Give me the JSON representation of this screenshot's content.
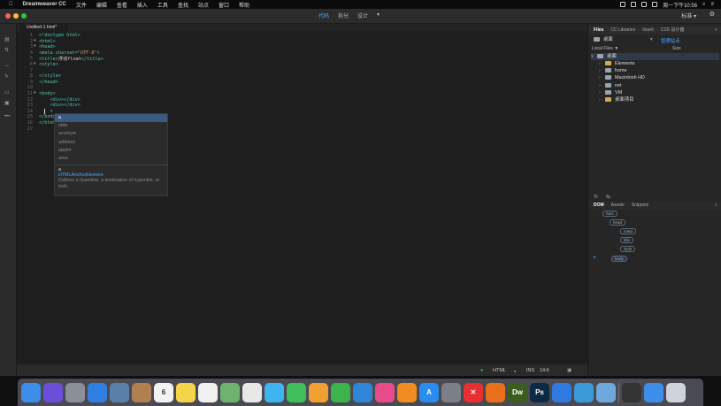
{
  "menubar": {
    "app_name": "Dreamweaver CC",
    "items": [
      "文件",
      "编辑",
      "查看",
      "插入",
      "工具",
      "查找",
      "站点",
      "窗口",
      "帮助"
    ],
    "clock": "周一下午10:56"
  },
  "titlebar": {
    "views": [
      "代码",
      "拆分",
      "设计"
    ],
    "workspace": "标准"
  },
  "doc_tab": "Untitled-1.html*",
  "editor": {
    "lines": [
      {
        "n": "1",
        "fold": "",
        "parts": [
          [
            "tag",
            "<!doctype html>"
          ]
        ]
      },
      {
        "n": "2",
        "fold": "▼",
        "parts": [
          [
            "tag",
            "<html>"
          ]
        ]
      },
      {
        "n": "3",
        "fold": "▼",
        "parts": [
          [
            "tag",
            "<head>"
          ]
        ]
      },
      {
        "n": "4",
        "fold": "",
        "parts": [
          [
            "tag",
            "<meta charset="
          ],
          [
            "str",
            "\"UTF-8\""
          ],
          [
            "tag",
            ">"
          ]
        ]
      },
      {
        "n": "5",
        "fold": "",
        "parts": [
          [
            "tag",
            "<title>"
          ],
          [
            "txt",
            "浮动float"
          ],
          [
            "tag",
            "</title>"
          ]
        ]
      },
      {
        "n": "6",
        "fold": "▼",
        "parts": [
          [
            "tag",
            "<style>"
          ]
        ]
      },
      {
        "n": "7",
        "fold": "",
        "parts": []
      },
      {
        "n": "8",
        "fold": "",
        "parts": [
          [
            "tag",
            "</style>"
          ]
        ]
      },
      {
        "n": "9",
        "fold": "",
        "parts": [
          [
            "tag",
            "</head>"
          ]
        ]
      },
      {
        "n": "10",
        "fold": "",
        "parts": []
      },
      {
        "n": "11",
        "fold": "▼",
        "parts": [
          [
            "tag",
            "<body>"
          ]
        ]
      },
      {
        "n": "12",
        "fold": "",
        "parts": [
          [
            "tag",
            "    <div></div>"
          ]
        ]
      },
      {
        "n": "13",
        "fold": "",
        "parts": [
          [
            "tag",
            "    <div></div>"
          ]
        ]
      },
      {
        "n": "14",
        "fold": "",
        "parts": [
          [
            "tag",
            "    <"
          ]
        ]
      },
      {
        "n": "15",
        "fold": "",
        "parts": [
          [
            "tag",
            "</body>"
          ]
        ]
      },
      {
        "n": "16",
        "fold": "",
        "parts": [
          [
            "tag",
            "</html>"
          ]
        ]
      },
      {
        "n": "17",
        "fold": "",
        "parts": []
      }
    ]
  },
  "autocomplete": {
    "items": [
      "a",
      "abbr",
      "acronym",
      "address",
      "applet",
      "area"
    ],
    "selected": "a",
    "detail_tag": "a",
    "detail_name": "HTMLAnchorElement",
    "detail_desc": "Defines a hyperlink, a destination of hyperlink, or both."
  },
  "status": {
    "language": "HTML",
    "mode": "INS",
    "position": "14:6"
  },
  "files_panel": {
    "tabs": [
      "Files",
      "CC Libraries",
      "Insert",
      "CSS 设计器"
    ],
    "location": "桌面",
    "manage": "管理站点",
    "col_local": "Local Files ▼",
    "col_size": "Size",
    "root": "桌面",
    "items": [
      {
        "name": "Elements",
        "type": "folder"
      },
      {
        "name": "home",
        "type": "drive"
      },
      {
        "name": "Macintosh HD",
        "type": "drive"
      },
      {
        "name": "net",
        "type": "drive"
      },
      {
        "name": "VM",
        "type": "drive"
      },
      {
        "name": "桌面项目",
        "type": "folder"
      }
    ]
  },
  "dom_panel": {
    "tabs": [
      "DOM",
      "Assets",
      "Snippets"
    ],
    "nodes": [
      "html",
      "head",
      "meta",
      "title",
      "style",
      "body"
    ]
  },
  "dock": {
    "calendar_day": "6",
    "apps": [
      {
        "name": "finder",
        "color": "#3d8ee8",
        "label": ""
      },
      {
        "name": "siri",
        "color": "#6b4fd8",
        "label": ""
      },
      {
        "name": "launchpad",
        "color": "#8a8f98",
        "label": ""
      },
      {
        "name": "safari",
        "color": "#2f7fe0",
        "label": ""
      },
      {
        "name": "preview",
        "color": "#5a7fa8",
        "label": ""
      },
      {
        "name": "notes-book",
        "color": "#b08050",
        "label": ""
      },
      {
        "name": "calendar",
        "color": "#f2f2f2",
        "label": "6"
      },
      {
        "name": "notes",
        "color": "#f4d54a",
        "label": ""
      },
      {
        "name": "reminders",
        "color": "#f0f0f0",
        "label": ""
      },
      {
        "name": "maps",
        "color": "#6db36d",
        "label": ""
      },
      {
        "name": "photos",
        "color": "#e8e8e8",
        "label": ""
      },
      {
        "name": "messages",
        "color": "#3eb5f0",
        "label": ""
      },
      {
        "name": "facetime",
        "color": "#3fbf5a",
        "label": ""
      },
      {
        "name": "pages",
        "color": "#f0a030",
        "label": ""
      },
      {
        "name": "numbers",
        "color": "#3cb44c",
        "label": ""
      },
      {
        "name": "keynote",
        "color": "#2f86d8",
        "label": ""
      },
      {
        "name": "itunes",
        "color": "#e84a8a",
        "label": ""
      },
      {
        "name": "ibooks",
        "color": "#f08c20",
        "label": ""
      },
      {
        "name": "app-store",
        "color": "#2a8cf0",
        "label": "A"
      },
      {
        "name": "system-preferences",
        "color": "#7a7f88",
        "label": ""
      },
      {
        "name": "xmind",
        "color": "#e83030",
        "label": "✕"
      },
      {
        "name": "firefox",
        "color": "#e8701a",
        "label": ""
      },
      {
        "name": "dreamweaver",
        "color": "#3b5e1e",
        "label": "Dw"
      },
      {
        "name": "photoshop",
        "color": "#0c2a44",
        "label": "Ps"
      },
      {
        "name": "baidu-netdisk",
        "color": "#2f7ae0",
        "label": ""
      },
      {
        "name": "qq-browser",
        "color": "#3a9ad8",
        "label": ""
      },
      {
        "name": "mail",
        "color": "#6fa8dc",
        "label": ""
      },
      {
        "name": "terminal-folder",
        "color": "#333333",
        "label": ""
      },
      {
        "name": "downloads",
        "color": "#3d8ee8",
        "label": ""
      },
      {
        "name": "trash",
        "color": "#cfd4da",
        "label": ""
      }
    ]
  },
  "colors": {
    "accent": "#49a8ff",
    "tag": "#4ec9b0",
    "string": "#ce9178",
    "selection": "#3a5a82"
  }
}
